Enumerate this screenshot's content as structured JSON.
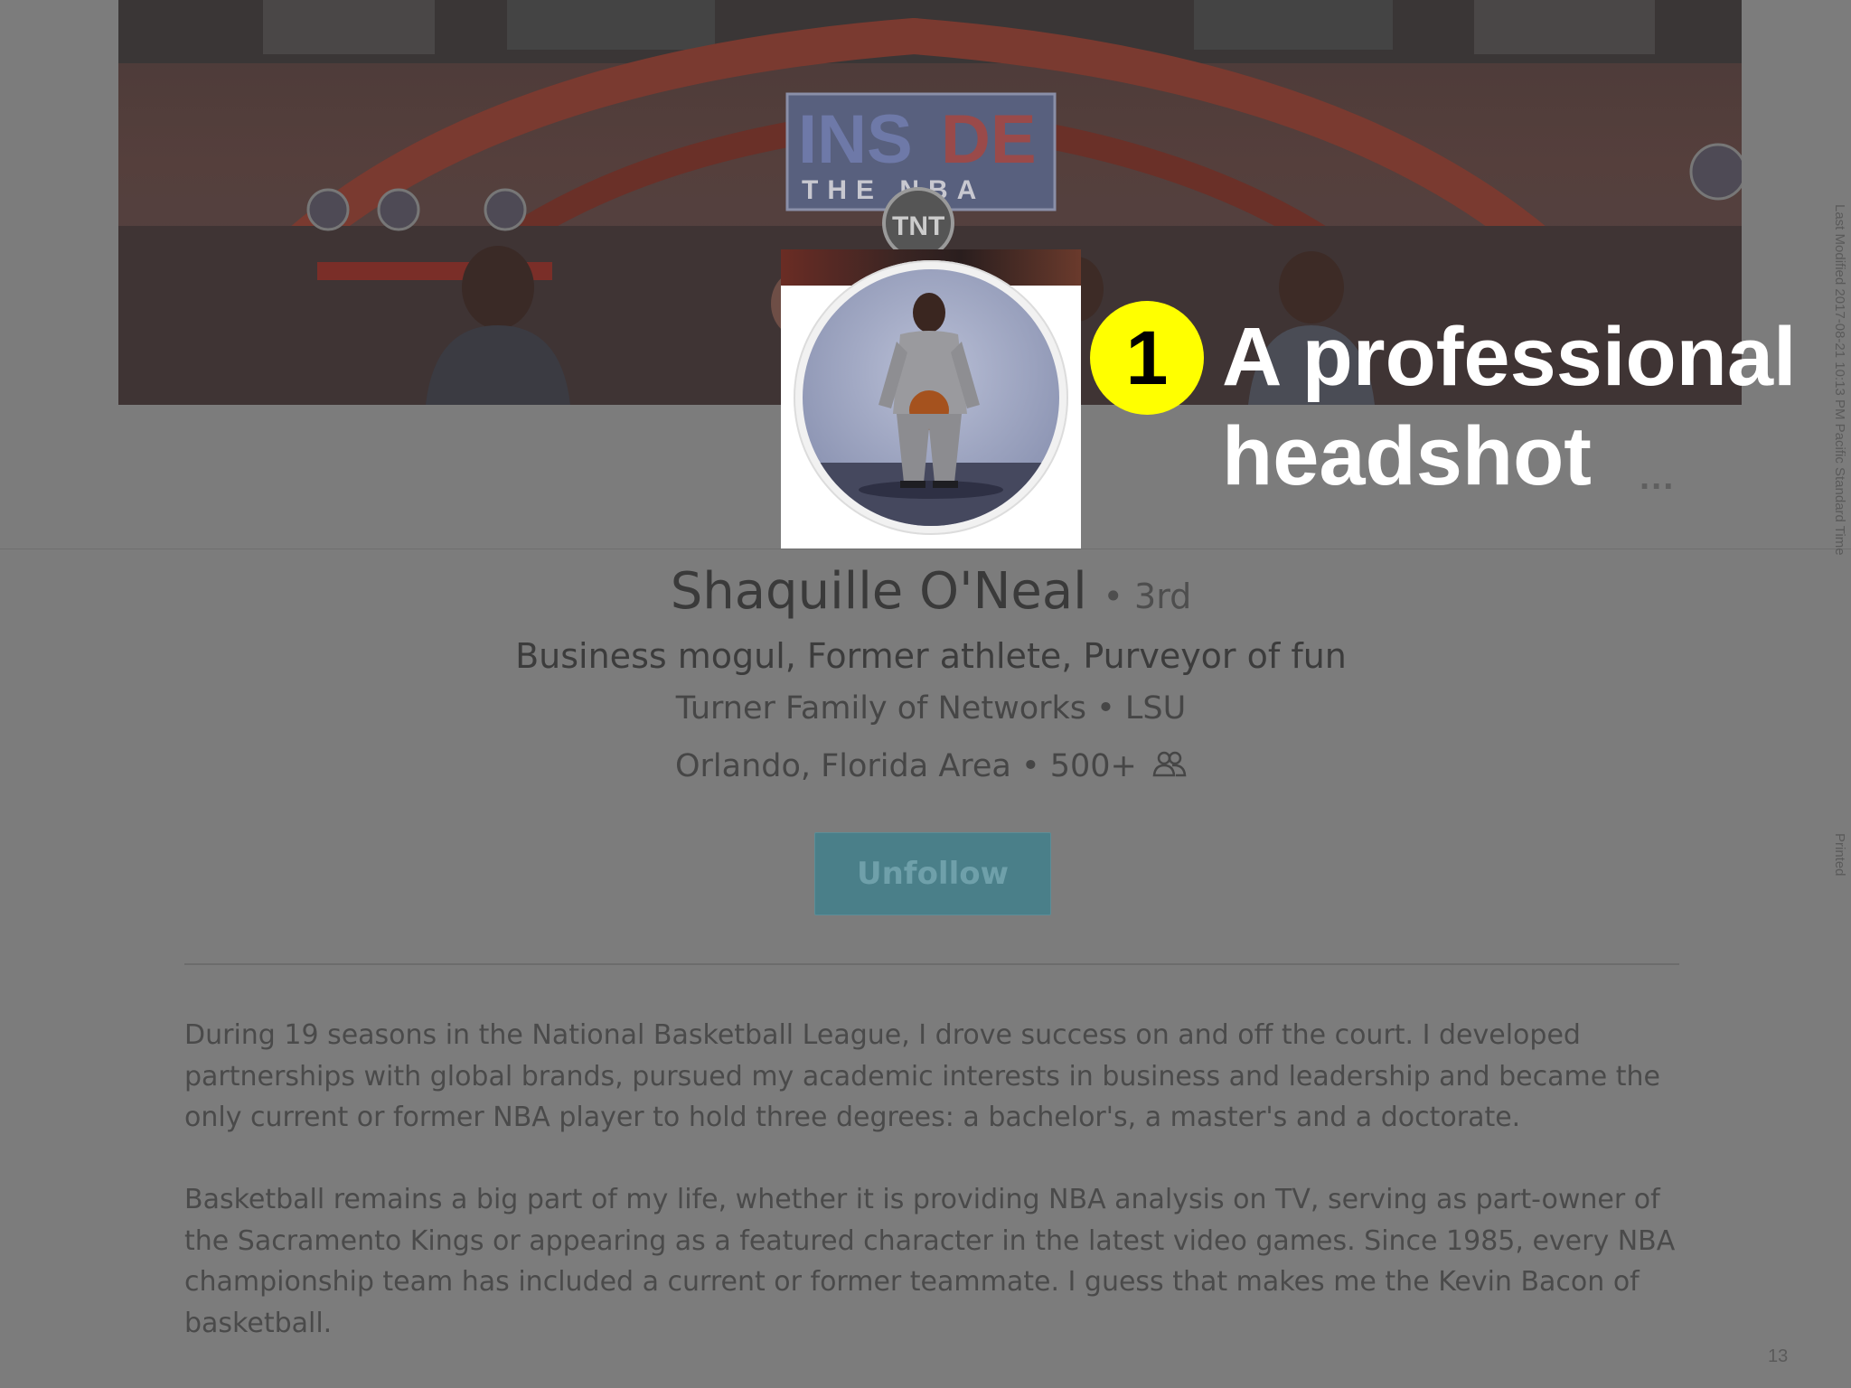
{
  "cover": {
    "logo_word_left": "INS",
    "logo_word_right": "DE",
    "logo_sub": "THE   NBA",
    "network": "TNT"
  },
  "annotation": {
    "number": "1",
    "line1": "A professional",
    "line2": "headshot"
  },
  "profile": {
    "name": "Shaquille O'Neal",
    "degree": "• 3rd",
    "headline": "Business mogul, Former athlete, Purveyor of fun",
    "company_line": "Turner Family of Networks • LSU",
    "location": "Orlando, Florida Area • 500+",
    "more_label": "...",
    "unfollow_label": "Unfollow"
  },
  "summary": {
    "paragraph1": "During 19 seasons in the National Basketball League, I drove success on and off the court. I developed partnerships with global brands, pursued my academic interests in business and leadership and became the only current or former NBA player to hold three degrees: a bachelor's, a master's and a doctorate.",
    "paragraph2": "Basketball remains a big part of my life, whether it is providing NBA analysis on TV, serving as part-owner of the Sacramento Kings or appearing as a featured character in the latest video games. Since 1985, every NBA championship team has included a current or former teammate. I guess that makes me the Kevin Bacon of basketball."
  },
  "slide": {
    "modified": "Last Modified 2017-08-21 10:13 PM Pacific Standard Time",
    "printed": "Printed",
    "page_number": "13"
  },
  "colors": {
    "background": "#7c7c7c",
    "badge": "#ffff00",
    "unfollow": "#4a7f89",
    "callout_text": "#ffffff"
  },
  "icons": {
    "connections": "people-icon"
  }
}
